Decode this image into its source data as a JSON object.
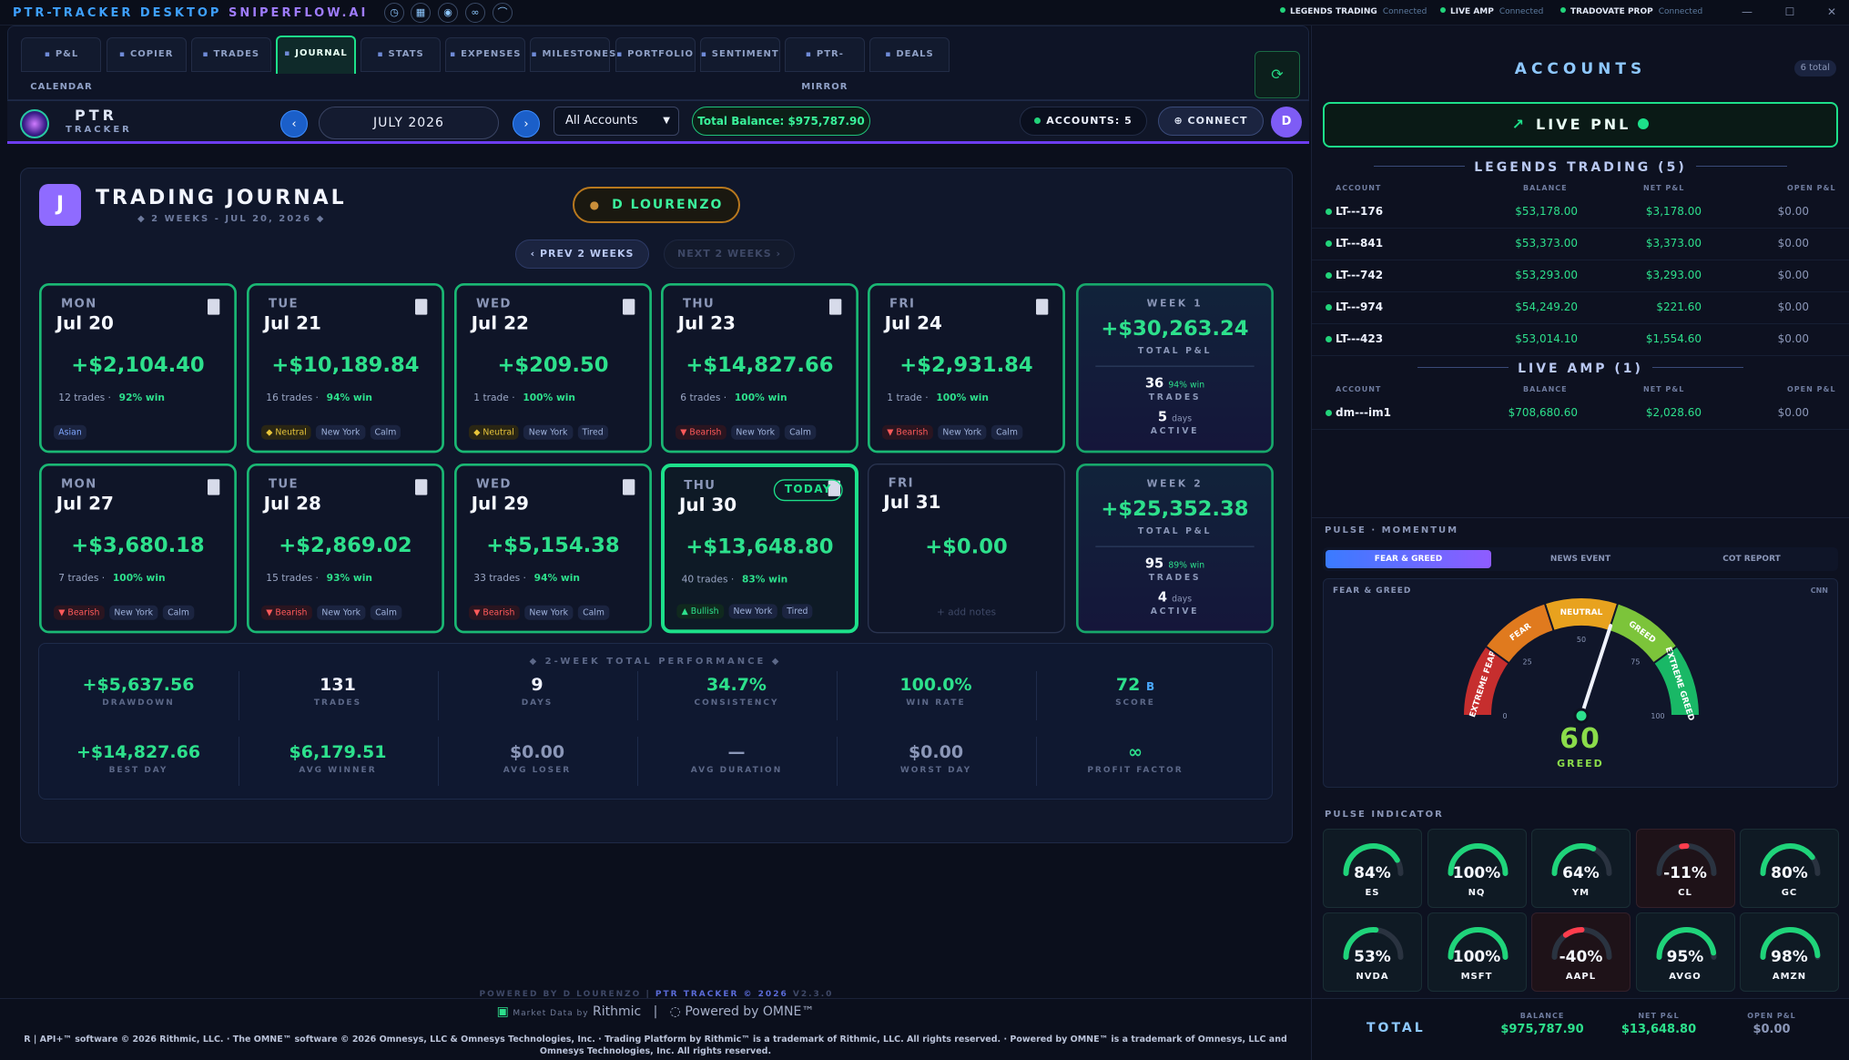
{
  "titlebar": {
    "app_name": "PTR-TRACKER DESKTOP",
    "app_sub": "SNIPERFLOW.AI",
    "icons": [
      "clock-icon",
      "calendar-icon",
      "eye-icon",
      "link-icon",
      "chart-icon"
    ],
    "connections": [
      {
        "name": "LEGENDS TRADING",
        "status": "Connected"
      },
      {
        "name": "LIVE AMP",
        "status": "Connected"
      },
      {
        "name": "TRADOVATE PROP",
        "status": "Connected"
      }
    ]
  },
  "tabs": [
    {
      "label": "P&L CALENDAR",
      "icon": "calendar-icon"
    },
    {
      "label": "COPIER",
      "icon": "copy-icon"
    },
    {
      "label": "TRADES",
      "icon": "list-icon"
    },
    {
      "label": "JOURNAL",
      "icon": "book-icon",
      "active": true
    },
    {
      "label": "STATS",
      "icon": "bar-chart-icon"
    },
    {
      "label": "EXPENSES",
      "icon": "money-icon"
    },
    {
      "label": "MILESTONES",
      "icon": "trophy-icon"
    },
    {
      "label": "PORTFOLIO",
      "icon": "portfolio-icon"
    },
    {
      "label": "SENTIMENT",
      "icon": "target-icon"
    },
    {
      "label": "PTR-MIRROR",
      "icon": "mirror-icon"
    },
    {
      "label": "DEALS",
      "icon": "tag-icon"
    }
  ],
  "controls": {
    "logo_title": "PTR",
    "logo_sub": "TRACKER",
    "month": "JULY 2026",
    "account_select": "All Accounts",
    "total_balance": "Total Balance: $975,787.90",
    "accounts_count": "ACCOUNTS: 5",
    "connect": "CONNECT",
    "avatar": "D"
  },
  "journal": {
    "icon_letter": "J",
    "title": "TRADING JOURNAL",
    "subtitle": "◆ 2 WEEKS - JUL 20, 2026 ◆",
    "user": "D LOURENZO",
    "prev": "‹ PREV 2 WEEKS",
    "next": "NEXT 2 WEEKS ›",
    "today_badge": "TODAY",
    "add_notes": "+ add notes",
    "days": [
      {
        "dow": "MON",
        "date": "Jul 20",
        "pnl": "+$2,104.40",
        "trades": "12 trades",
        "win": "92% win",
        "tags": [
          {
            "t": "Asian",
            "k": "asian"
          }
        ]
      },
      {
        "dow": "TUE",
        "date": "Jul 21",
        "pnl": "+$10,189.84",
        "trades": "16 trades",
        "win": "94% win",
        "tags": [
          {
            "t": "◆ Neutral",
            "k": "neutral"
          },
          {
            "t": "New York",
            "k": ""
          },
          {
            "t": "Calm",
            "k": ""
          }
        ]
      },
      {
        "dow": "WED",
        "date": "Jul 22",
        "pnl": "+$209.50",
        "trades": "1 trade",
        "win": "100% win",
        "tags": [
          {
            "t": "◆ Neutral",
            "k": "neutral"
          },
          {
            "t": "New York",
            "k": ""
          },
          {
            "t": "Tired",
            "k": ""
          }
        ]
      },
      {
        "dow": "THU",
        "date": "Jul 23",
        "pnl": "+$14,827.66",
        "trades": "6 trades",
        "win": "100% win",
        "tags": [
          {
            "t": "▼ Bearish",
            "k": "bearish"
          },
          {
            "t": "New York",
            "k": ""
          },
          {
            "t": "Calm",
            "k": ""
          }
        ]
      },
      {
        "dow": "FRI",
        "date": "Jul 24",
        "pnl": "+$2,931.84",
        "trades": "1 trade",
        "win": "100% win",
        "tags": [
          {
            "t": "▼ Bearish",
            "k": "bearish"
          },
          {
            "t": "New York",
            "k": ""
          },
          {
            "t": "Calm",
            "k": ""
          }
        ]
      },
      {
        "dow": "MON",
        "date": "Jul 27",
        "pnl": "+$3,680.18",
        "trades": "7 trades",
        "win": "100% win",
        "tags": [
          {
            "t": "▼ Bearish",
            "k": "bearish"
          },
          {
            "t": "New York",
            "k": ""
          },
          {
            "t": "Calm",
            "k": ""
          }
        ]
      },
      {
        "dow": "TUE",
        "date": "Jul 28",
        "pnl": "+$2,869.02",
        "trades": "15 trades",
        "win": "93% win",
        "tags": [
          {
            "t": "▼ Bearish",
            "k": "bearish"
          },
          {
            "t": "New York",
            "k": ""
          },
          {
            "t": "Calm",
            "k": ""
          }
        ]
      },
      {
        "dow": "WED",
        "date": "Jul 29",
        "pnl": "+$5,154.38",
        "trades": "33 trades",
        "win": "94% win",
        "tags": [
          {
            "t": "▼ Bearish",
            "k": "bearish"
          },
          {
            "t": "New York",
            "k": ""
          },
          {
            "t": "Calm",
            "k": ""
          }
        ]
      },
      {
        "dow": "THU",
        "date": "Jul 30",
        "pnl": "+$13,648.80",
        "trades": "40 trades",
        "win": "83% win",
        "today": true,
        "tags": [
          {
            "t": "▲ Bullish",
            "k": "bullish"
          },
          {
            "t": "New York",
            "k": ""
          },
          {
            "t": "Tired",
            "k": ""
          }
        ]
      },
      {
        "dow": "FRI",
        "date": "Jul 31",
        "pnl": "+$0.00",
        "trades": "",
        "win": "",
        "empty": true,
        "tags": []
      }
    ],
    "weeks": [
      {
        "label": "WEEK 1",
        "total": "+$30,263.24",
        "total_label": "TOTAL P&L",
        "trades": "36",
        "win": "94% win",
        "trades_label": "TRADES",
        "days": "5",
        "days_unit": "days",
        "active_label": "ACTIVE"
      },
      {
        "label": "WEEK 2",
        "total": "+$25,352.38",
        "total_label": "TOTAL P&L",
        "trades": "95",
        "win": "89% win",
        "trades_label": "TRADES",
        "days": "4",
        "days_unit": "days",
        "active_label": "ACTIVE"
      }
    ]
  },
  "performance": {
    "title": "◆ 2-WEEK TOTAL PERFORMANCE ◆",
    "row1": [
      {
        "v": "+$5,637.56",
        "l": "DRAWDOWN",
        "c": ""
      },
      {
        "v": "131",
        "l": "TRADES",
        "c": "wht"
      },
      {
        "v": "9",
        "l": "DAYS",
        "c": "wht"
      },
      {
        "v": "34.7%",
        "l": "CONSISTENCY",
        "c": ""
      },
      {
        "v": "100.0%",
        "l": "WIN RATE",
        "c": ""
      },
      {
        "v": "72",
        "suffix": "B",
        "l": "SCORE",
        "c": ""
      }
    ],
    "row2": [
      {
        "v": "+$14,827.66",
        "l": "BEST DAY",
        "c": ""
      },
      {
        "v": "$6,179.51",
        "l": "AVG WINNER",
        "c": ""
      },
      {
        "v": "$0.00",
        "l": "AVG LOSER",
        "c": "gry"
      },
      {
        "v": "—",
        "l": "AVG DURATION",
        "c": "gry"
      },
      {
        "v": "$0.00",
        "l": "WORST DAY",
        "c": "gry"
      },
      {
        "v": "∞",
        "l": "PROFIT FACTOR",
        "c": ""
      }
    ]
  },
  "footer": {
    "powered_by": "POWERED BY D LOURENZO",
    "brand": "PTR TRACKER © 2026",
    "version": "V2.3.0",
    "market_data_prefix": "Market Data by",
    "rithmic": "Rithmic",
    "omne": "Powered by OMNE™",
    "legal": "R | API+™ software © 2026 Rithmic, LLC.  ·  The OMNE™ software © 2026 Omnesys, LLC & Omnesys Technologies, Inc.  ·  Trading Platform by Rithmic™ is a trademark of Rithmic, LLC. All rights reserved.  ·  Powered by OMNE™ is a trademark of Omnesys, LLC and Omnesys Technologies, Inc. All rights reserved."
  },
  "accounts": {
    "title": "ACCOUNTS",
    "total_badge": "6 total",
    "live_pnl": "LIVE PNL",
    "cols": [
      "ACCOUNT",
      "BALANCE",
      "NET P&L",
      "OPEN P&L"
    ],
    "groups": [
      {
        "name": "LEGENDS TRADING (5)",
        "rows": [
          {
            "acct": "LT---176",
            "bal": "$53,178.00",
            "net": "$3,178.00",
            "open": "$0.00"
          },
          {
            "acct": "LT---841",
            "bal": "$53,373.00",
            "net": "$3,373.00",
            "open": "$0.00"
          },
          {
            "acct": "LT---742",
            "bal": "$53,293.00",
            "net": "$3,293.00",
            "open": "$0.00"
          },
          {
            "acct": "LT---974",
            "bal": "$54,249.20",
            "net": "$221.60",
            "open": "$0.00"
          },
          {
            "acct": "LT---423",
            "bal": "$53,014.10",
            "net": "$1,554.60",
            "open": "$0.00"
          }
        ]
      },
      {
        "name": "LIVE AMP (1)",
        "rows": [
          {
            "acct": "dm---im1",
            "bal": "$708,680.60",
            "net": "$2,028.60",
            "open": "$0.00"
          }
        ]
      }
    ],
    "total": {
      "label": "TOTAL",
      "bal_h": "BALANCE",
      "bal": "$975,787.90",
      "net_h": "NET P&L",
      "net": "$13,648.80",
      "open_h": "OPEN P&L",
      "open": "$0.00"
    }
  },
  "pulse": {
    "title": "PULSE · MOMENTUM",
    "tabs": [
      "FEAR & GREED",
      "NEWS EVENT",
      "COT REPORT"
    ],
    "fg_label": "FEAR & GREED",
    "fg_source": "CNN",
    "gauge_value": 60,
    "gauge_text": "60",
    "gauge_state": "GREED",
    "segments": [
      "EXTREME FEAR",
      "FEAR",
      "NEUTRAL",
      "GREED",
      "EXTREME GREED"
    ],
    "ticks": [
      "0",
      "25",
      "50",
      "75",
      "100"
    ],
    "indicator_title": "PULSE INDICATOR",
    "indicators": [
      {
        "v": "84%",
        "n": "ES",
        "p": 84
      },
      {
        "v": "100%",
        "n": "NQ",
        "p": 100
      },
      {
        "v": "64%",
        "n": "YM",
        "p": 64
      },
      {
        "v": "-11%",
        "n": "CL",
        "p": -11
      },
      {
        "v": "80%",
        "n": "GC",
        "p": 80
      },
      {
        "v": "53%",
        "n": "NVDA",
        "p": 53
      },
      {
        "v": "100%",
        "n": "MSFT",
        "p": 100
      },
      {
        "v": "-40%",
        "n": "AAPL",
        "p": -40
      },
      {
        "v": "95%",
        "n": "AVGO",
        "p": 95
      },
      {
        "v": "98%",
        "n": "AMZN",
        "p": 98
      }
    ],
    "colors": {
      "pos": "#1fd47a",
      "neg": "#ff3d4d",
      "track": "#2a3340"
    }
  }
}
